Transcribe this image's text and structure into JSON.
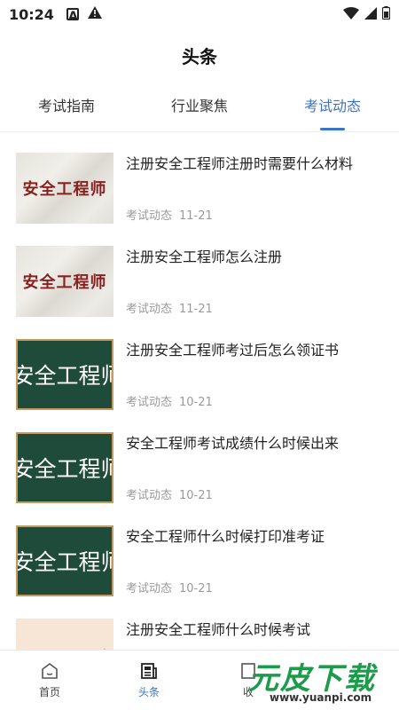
{
  "status": {
    "time": "10:24"
  },
  "header": {
    "title": "头条"
  },
  "tabs": [
    {
      "label": "考试指南"
    },
    {
      "label": "行业聚焦"
    },
    {
      "label": "考试动态"
    }
  ],
  "articles": [
    {
      "title": "注册安全工程师注册时需要什么材料",
      "category": "考试动态",
      "date": "11-21",
      "thumb_text": "安全工程师"
    },
    {
      "title": "注册安全工程师怎么注册",
      "category": "考试动态",
      "date": "11-21",
      "thumb_text": "安全工程师"
    },
    {
      "title": "注册安全工程师考过后怎么领证书",
      "category": "考试动态",
      "date": "10-21",
      "thumb_text": "安全工程师"
    },
    {
      "title": "安全工程师考试成绩什么时候出来",
      "category": "考试动态",
      "date": "10-21",
      "thumb_text": "安全工程师"
    },
    {
      "title": "安全工程师什么时候打印准考证",
      "category": "考试动态",
      "date": "10-21",
      "thumb_text": "安全工程师"
    },
    {
      "title": "注册安全工程师什么时候考试",
      "category": "",
      "date": "",
      "thumb_text": ""
    }
  ],
  "bottom_nav": [
    {
      "label": "首页"
    },
    {
      "label": "头条"
    },
    {
      "label": "收"
    }
  ],
  "watermark": {
    "text": "元皮下载",
    "url": "www.yuanpi.com"
  },
  "colors": {
    "accent": "#3a73c8",
    "meta": "#9a9a9a"
  }
}
